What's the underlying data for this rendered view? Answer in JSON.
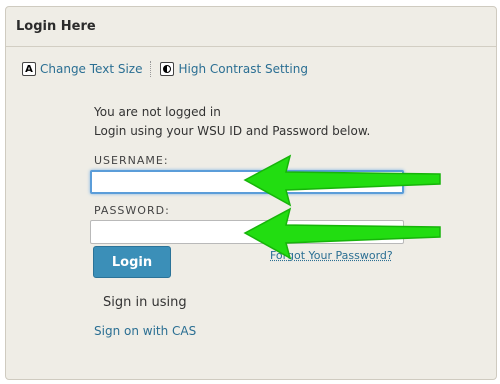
{
  "panel": {
    "title": "Login Here"
  },
  "accessibility": {
    "text_size": {
      "icon": "A",
      "label": "Change Text Size"
    },
    "contrast": {
      "icon": "contrast-icon",
      "label": "High Contrast Setting"
    }
  },
  "status": {
    "line1": "You are not logged in",
    "line2": "Login using your WSU ID and Password below."
  },
  "form": {
    "username_label": "USERNAME:",
    "username_value": "",
    "password_label": "PASSWORD:",
    "password_value": "",
    "login_button": "Login",
    "forgot_link": "Forgot Your Password?"
  },
  "alt_login": {
    "heading": "Sign in using",
    "cas_link": "Sign on with CAS"
  },
  "annotations": {
    "arrow_color": "#22dd11"
  }
}
